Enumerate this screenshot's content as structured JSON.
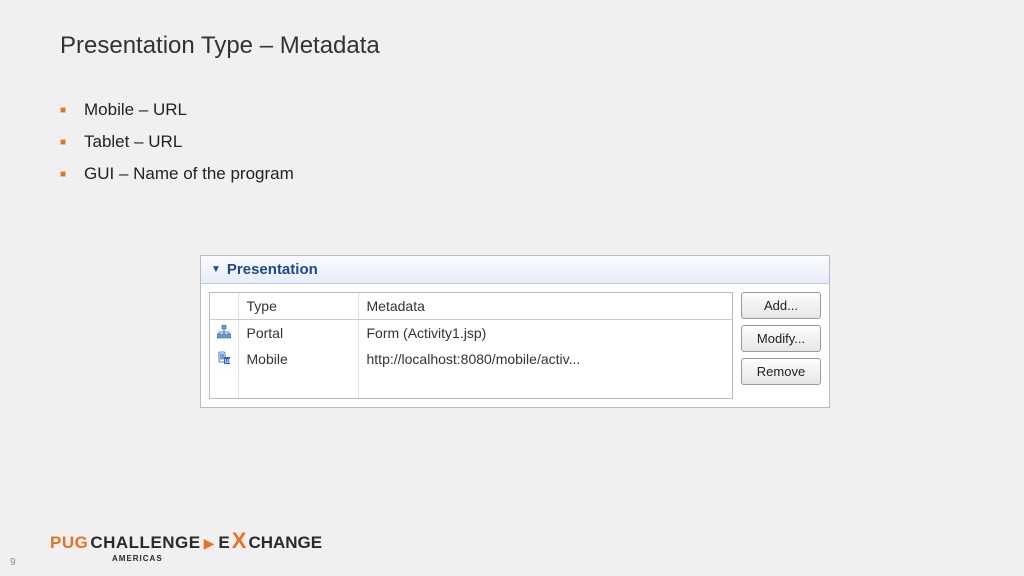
{
  "title": "Presentation Type – Metadata",
  "bullets": [
    "Mobile – URL",
    "Tablet – URL",
    "GUI – Name of the program"
  ],
  "panel": {
    "title": "Presentation",
    "columns": {
      "icon": "",
      "type": "Type",
      "metadata": "Metadata"
    },
    "rows": [
      {
        "icon": "portal",
        "type": "Portal",
        "metadata": "Form (Activity1.jsp)"
      },
      {
        "icon": "mobile",
        "type": "Mobile",
        "metadata": "http://localhost:8080/mobile/activ..."
      }
    ],
    "buttons": {
      "add": "Add...",
      "modify": "Modify...",
      "remove": "Remove"
    }
  },
  "footer": {
    "logo": {
      "pug": "PUG",
      "challenge": "CHALLENGE",
      "e": "E",
      "x": "X",
      "change": "CHANGE",
      "sub": "AMERICAS"
    },
    "slide_number": "9"
  }
}
